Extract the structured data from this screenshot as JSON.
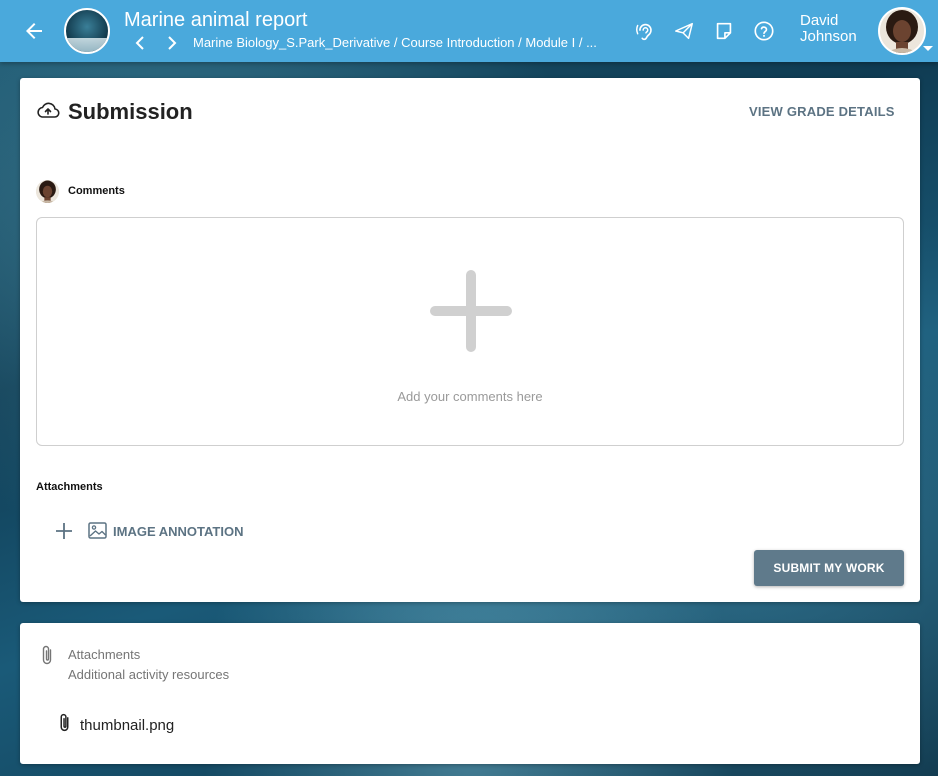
{
  "header": {
    "title": "Marine animal report",
    "breadcrumb": "Marine Biology_S.Park_Derivative / Course Introduction / Module I / ...",
    "user_first": "David",
    "user_last": "Johnson",
    "accent": "#4aa9dc",
    "icons": [
      "arrow-left-icon",
      "chevron-left-icon",
      "chevron-right-icon",
      "hearing-icon",
      "send-icon",
      "note-icon",
      "help-icon"
    ]
  },
  "submission": {
    "title": "Submission",
    "view_grade_label": "VIEW GRADE DETAILS",
    "comments_label": "Comments",
    "comment_placeholder": "Add your comments here",
    "attachments_label": "Attachments",
    "image_annotation_label": "IMAGE ANNOTATION",
    "submit_label": "SUBMIT MY WORK",
    "button_color": "#5f7a8b"
  },
  "resources": {
    "title": "Attachments",
    "subtitle": "Additional activity resources",
    "files": [
      {
        "name": "thumbnail.png"
      }
    ]
  }
}
